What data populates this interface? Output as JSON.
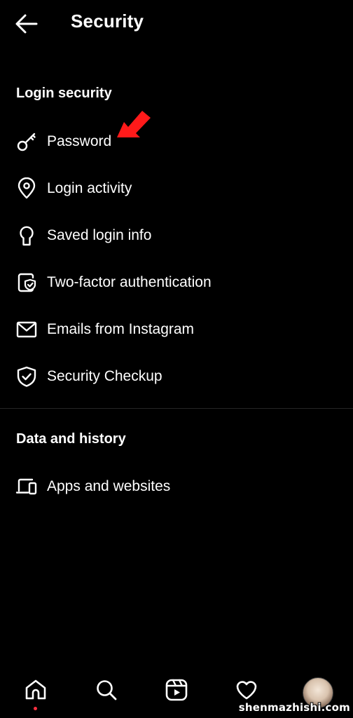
{
  "header": {
    "title": "Security",
    "back_icon": "arrow-left-icon"
  },
  "sections": [
    {
      "title": "Login security",
      "items": [
        {
          "label": "Password",
          "icon": "key-icon"
        },
        {
          "label": "Login activity",
          "icon": "location-pin-icon"
        },
        {
          "label": "Saved login info",
          "icon": "keyhole-icon"
        },
        {
          "label": "Two-factor authentication",
          "icon": "phone-shield-icon"
        },
        {
          "label": "Emails from Instagram",
          "icon": "envelope-icon"
        },
        {
          "label": "Security Checkup",
          "icon": "shield-check-icon"
        }
      ]
    },
    {
      "title": "Data and history",
      "items": [
        {
          "label": "Apps and websites",
          "icon": "devices-icon"
        }
      ]
    }
  ],
  "annotation": {
    "arrow_color": "#ff1a1a",
    "points_to": "Password"
  },
  "bottom_nav": {
    "items": [
      {
        "name": "home",
        "icon": "home-icon",
        "notification_dot": true
      },
      {
        "name": "search",
        "icon": "search-icon",
        "notification_dot": false
      },
      {
        "name": "reels",
        "icon": "reels-icon",
        "notification_dot": false
      },
      {
        "name": "activity",
        "icon": "heart-icon",
        "notification_dot": true
      },
      {
        "name": "profile",
        "icon": "avatar",
        "notification_dot": false
      }
    ]
  },
  "watermark": "shenmazhishi.com",
  "colors": {
    "background": "#000000",
    "text": "#ffffff",
    "divider": "#262626",
    "notification": "#ff3040"
  }
}
